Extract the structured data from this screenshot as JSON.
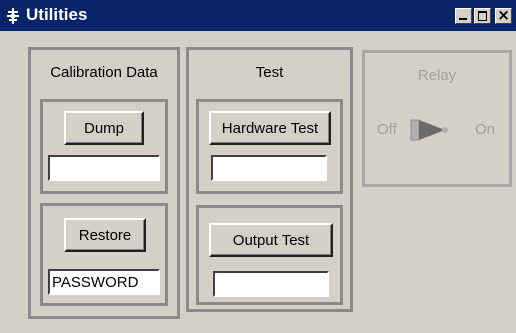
{
  "window": {
    "title": "Utilities",
    "icon": "utilities-icon"
  },
  "titlebar_buttons": {
    "minimize": "minimize-icon",
    "maximize": "maximize-icon",
    "close": "×"
  },
  "calibration": {
    "heading": "Calibration Data",
    "dump_label": "Dump",
    "dump_value": "",
    "restore_label": "Restore",
    "restore_value": "PASSWORD"
  },
  "test": {
    "heading": "Test",
    "hardware_label": "Hardware Test",
    "hardware_value": "",
    "output_label": "Output Test",
    "output_value": ""
  },
  "relay": {
    "heading": "Relay",
    "off_label": "Off",
    "on_label": "On",
    "state": "off",
    "enabled": false
  },
  "colors": {
    "titlebar": "#0a246a",
    "face": "#d4d0c8",
    "disabled_text": "#a0a0a0"
  }
}
